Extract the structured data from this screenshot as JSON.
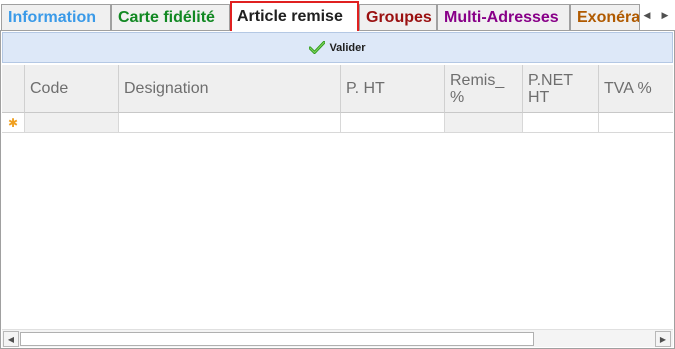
{
  "tabs": [
    {
      "label": "Information",
      "color": "#3a9ae8",
      "active": false
    },
    {
      "label": "Carte fidélité",
      "color": "#118822",
      "active": false
    },
    {
      "label": "Article remise",
      "color": "#202020",
      "active": true
    },
    {
      "label": "Groupes",
      "color": "#9a1010",
      "active": false
    },
    {
      "label": "Multi-Adresses",
      "color": "#880088",
      "active": false
    },
    {
      "label": "Exonéra",
      "color": "#b05a00",
      "active": false
    }
  ],
  "tab_scroll": {
    "left_icon": "◀",
    "right_icon": "▶"
  },
  "toolbar": {
    "valider_label": "Valider",
    "valider_icon": "green-checkmark"
  },
  "grid": {
    "columns": [
      "Code",
      "Designation",
      "P. HT",
      "Remis_\n%",
      "P.NET\nHT",
      "TVA %"
    ],
    "new_row_marker": "✱"
  },
  "scrollbar": {
    "left_icon": "◀",
    "right_icon": "▶"
  }
}
